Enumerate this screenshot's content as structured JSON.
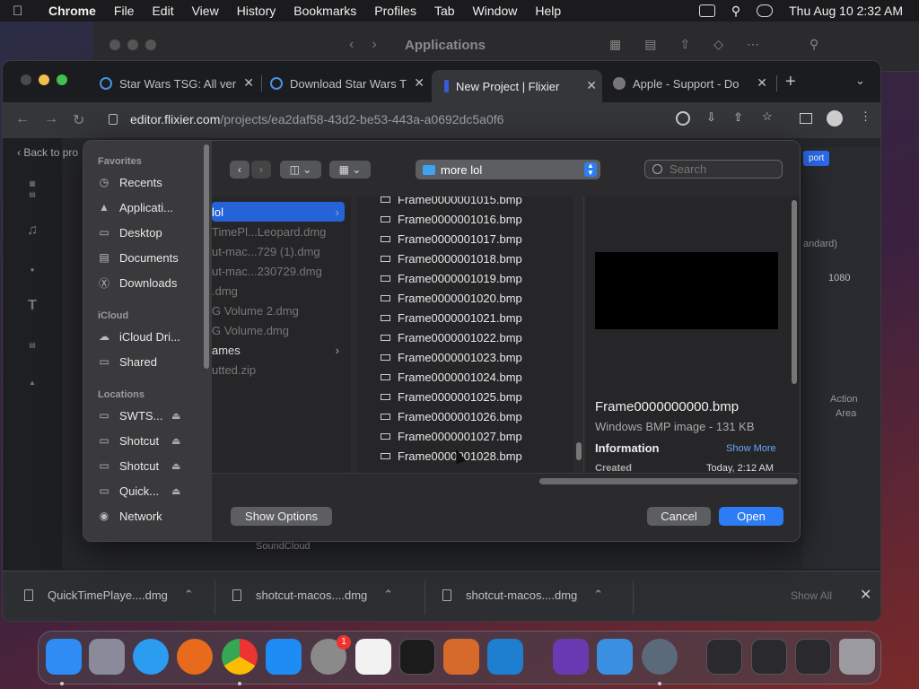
{
  "menubar": {
    "app": "Chrome",
    "items": [
      "File",
      "Edit",
      "View",
      "History",
      "Bookmarks",
      "Profiles",
      "Tab",
      "Window",
      "Help"
    ],
    "clock": "Thu Aug 10  2:32 AM"
  },
  "finder_bg": {
    "title": "Applications"
  },
  "chrome": {
    "tabs": [
      {
        "title": "Star Wars TSG: All ver",
        "color": "#4a90e2"
      },
      {
        "title": "Download Star Wars T",
        "color": "#4a90e2"
      },
      {
        "title": "New Project | Flixier",
        "color": "#3a5bd6"
      },
      {
        "title": "Apple - Support - Do",
        "color": "#888888"
      }
    ],
    "url_host": "editor.flixier.com",
    "url_path": "/projects/ea2daf58-43d2-be53-443a-a0692dc5a0f6",
    "back_link": "Back to pro"
  },
  "downloads": {
    "items": [
      "QuickTimePlaye....dmg",
      "shotcut-macos....dmg",
      "shotcut-macos....dmg"
    ],
    "show_all": "Show All"
  },
  "dialog": {
    "sidebar": {
      "favorites_header": "Favorites",
      "favorites": [
        {
          "label": "Recents",
          "icon": "clock-icon"
        },
        {
          "label": "Applicati...",
          "icon": "apps-icon"
        },
        {
          "label": "Desktop",
          "icon": "desktop-icon"
        },
        {
          "label": "Documents",
          "icon": "document-icon"
        },
        {
          "label": "Downloads",
          "icon": "download-icon"
        }
      ],
      "icloud_header": "iCloud",
      "icloud": [
        {
          "label": "iCloud Dri...",
          "icon": "cloud-icon"
        },
        {
          "label": "Shared",
          "icon": "shared-folder-icon"
        }
      ],
      "locations_header": "Locations",
      "locations": [
        {
          "label": "SWTS...",
          "icon": "disk-icon"
        },
        {
          "label": "Shotcut",
          "icon": "disk-icon"
        },
        {
          "label": "Shotcut",
          "icon": "disk-icon"
        },
        {
          "label": "Quick...",
          "icon": "disk-icon"
        },
        {
          "label": "Network",
          "icon": "globe-icon"
        }
      ]
    },
    "path_selector": "more lol",
    "search_placeholder": "Search",
    "column1": [
      "lol",
      "TimePl...Leopard.dmg",
      "ut-mac...729 (1).dmg",
      "ut-mac...230729.dmg",
      ".dmg",
      "G Volume 2.dmg",
      "G Volume.dmg",
      "ames",
      "utted.zip"
    ],
    "column2": [
      "Frame0000001015.bmp",
      "Frame0000001016.bmp",
      "Frame0000001017.bmp",
      "Frame0000001018.bmp",
      "Frame0000001019.bmp",
      "Frame0000001020.bmp",
      "Frame0000001021.bmp",
      "Frame0000001022.bmp",
      "Frame0000001023.bmp",
      "Frame0000001024.bmp",
      "Frame0000001025.bmp",
      "Frame0000001026.bmp",
      "Frame0000001027.bmp",
      "Frame0000001028.bmp"
    ],
    "preview": {
      "name": "Frame0000000000.bmp",
      "kind": "Windows BMP image - 131 KB",
      "info_label": "Information",
      "show_more": "Show More",
      "created_label": "Created",
      "created_value": "Today, 2:12 AM"
    },
    "show_options": "Show Options",
    "cancel": "Cancel",
    "open": "Open"
  },
  "behind_labels": {
    "soundcloud": "SoundCloud",
    "resolution": "1080",
    "standard": "andard)",
    "action": "Action",
    "area": "Area",
    "upload": "port"
  },
  "dock": {
    "apps": [
      {
        "name": "finder",
        "color": "#2f8cf5"
      },
      {
        "name": "launchpad",
        "color": "#8a8a9a"
      },
      {
        "name": "safari",
        "color": "#2c9cf0"
      },
      {
        "name": "firefox",
        "color": "#e86a1c"
      },
      {
        "name": "chrome",
        "color": "#e9e9e9"
      },
      {
        "name": "app-store",
        "color": "#1f8cf5"
      },
      {
        "name": "system-settings",
        "color": "#8a8a8a"
      },
      {
        "name": "textedit",
        "color": "#f2f2f2"
      },
      {
        "name": "terminal",
        "color": "#1b1b1b"
      },
      {
        "name": "garageband",
        "color": "#d56a2a"
      },
      {
        "name": "vscode",
        "color": "#1e7fd0"
      },
      {
        "name": "visual-studio",
        "color": "#6a3ab2"
      },
      {
        "name": "weather",
        "color": "#3a8fe0"
      },
      {
        "name": "quicktime",
        "color": "#5a6a7a"
      },
      {
        "name": "folder-1",
        "color": "#2a2a2e"
      },
      {
        "name": "folder-2",
        "color": "#2a2a2e"
      },
      {
        "name": "folder-3",
        "color": "#2a2a2e"
      },
      {
        "name": "trash",
        "color": "#9a9aa0"
      }
    ],
    "settings_badge": "1"
  }
}
